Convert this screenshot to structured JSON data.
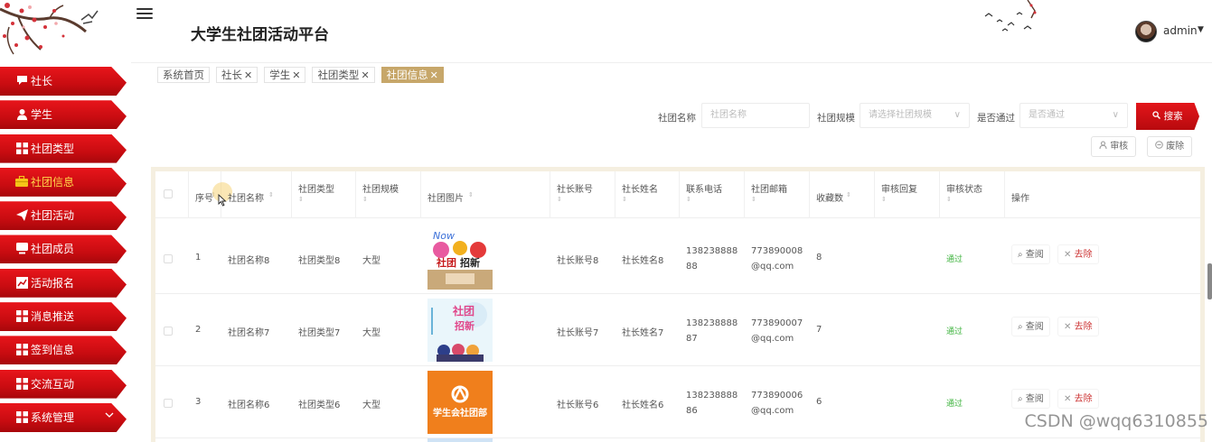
{
  "app": {
    "title": "大学生社团活动平台",
    "user": "admin",
    "accent": "#d0121a",
    "tab_active_color": "#c7a76a"
  },
  "sidebar": {
    "items": [
      {
        "label": "社长",
        "icon": "comment-icon"
      },
      {
        "label": "学生",
        "icon": "user-icon"
      },
      {
        "label": "社团类型",
        "icon": "grid-icon"
      },
      {
        "label": "社团信息",
        "icon": "briefcase-icon"
      },
      {
        "label": "社团活动",
        "icon": "send-icon"
      },
      {
        "label": "社团成员",
        "icon": "monitor-icon"
      },
      {
        "label": "活动报名",
        "icon": "chart-icon"
      },
      {
        "label": "消息推送",
        "icon": "grid-icon"
      },
      {
        "label": "签到信息",
        "icon": "grid-icon"
      },
      {
        "label": "交流互动",
        "icon": "grid-icon"
      },
      {
        "label": "系统管理",
        "icon": "grid-icon"
      }
    ]
  },
  "tabs": [
    {
      "label": "系统首页",
      "closable": false,
      "active": false
    },
    {
      "label": "社长",
      "closable": true,
      "active": false
    },
    {
      "label": "学生",
      "closable": true,
      "active": false
    },
    {
      "label": "社团类型",
      "closable": true,
      "active": false
    },
    {
      "label": "社团信息",
      "closable": true,
      "active": true
    }
  ],
  "search": {
    "name_label": "社团名称",
    "name_placeholder": "社团名称",
    "scale_label": "社团规模",
    "scale_placeholder": "请选择社团规模",
    "passed_label": "是否通过",
    "passed_placeholder": "是否通过",
    "search_button": "搜索"
  },
  "actions": {
    "review": "审核",
    "deprecate": "废除"
  },
  "table": {
    "headers": [
      "序号",
      "社团名称",
      "社团类型",
      "社团规模",
      "社团图片",
      "社长账号",
      "社长姓名",
      "联系电话",
      "社团邮箱",
      "收藏数",
      "审核回复",
      "审核状态",
      "操作"
    ],
    "rows": [
      {
        "no": "1",
        "name": "社团名称8",
        "type": "社团类型8",
        "scale": "大型",
        "leader_account": "社长账号8",
        "leader_name": "社长姓名8",
        "phone_a": "138238888",
        "phone_b": "88",
        "email_a": "773890008",
        "email_b": "@qq.com",
        "favorites": "8",
        "reply": "",
        "status": "通过",
        "view": "查阅",
        "delete": "去除"
      },
      {
        "no": "2",
        "name": "社团名称7",
        "type": "社团类型7",
        "scale": "大型",
        "leader_account": "社长账号7",
        "leader_name": "社长姓名7",
        "phone_a": "138238888",
        "phone_b": "87",
        "email_a": "773890007",
        "email_b": "@qq.com",
        "favorites": "7",
        "reply": "",
        "status": "通过",
        "view": "查阅",
        "delete": "去除"
      },
      {
        "no": "3",
        "name": "社团名称6",
        "type": "社团类型6",
        "scale": "大型",
        "leader_account": "社长账号6",
        "leader_name": "社长姓名6",
        "phone_a": "138238888",
        "phone_b": "86",
        "email_a": "773890006",
        "email_b": "@qq.com",
        "favorites": "6",
        "reply": "",
        "status": "通过",
        "view": "查阅",
        "delete": "去除"
      }
    ]
  },
  "posters": [
    {
      "text_top": "Now",
      "text_mid": "社团",
      "text_bottom": "招新"
    },
    {
      "text_top": "社团",
      "text_mid": "招新",
      "text_bottom": ""
    },
    {
      "text_top": "",
      "text_mid": "学生会社团部",
      "text_bottom": ""
    }
  ],
  "watermark": "CSDN @wqq6310855"
}
